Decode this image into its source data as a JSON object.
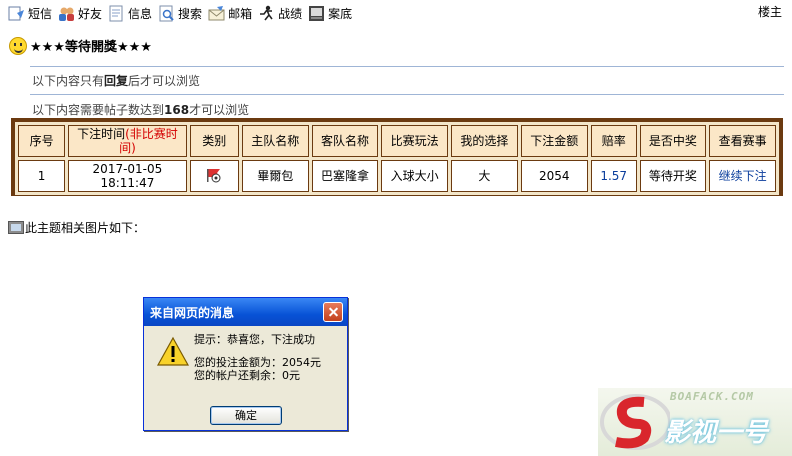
{
  "toolbar": {
    "items": [
      {
        "label": "短信",
        "icon": "message-icon"
      },
      {
        "label": "好友",
        "icon": "friends-icon"
      },
      {
        "label": "信息",
        "icon": "info-icon"
      },
      {
        "label": "搜索",
        "icon": "search-icon"
      },
      {
        "label": "邮箱",
        "icon": "mail-icon"
      },
      {
        "label": "战绩",
        "icon": "record-icon"
      },
      {
        "label": "案底",
        "icon": "file-icon"
      }
    ],
    "floor_label": "楼主"
  },
  "post": {
    "title": "★★★等待開獎★★★",
    "notice1_prefix": "以下内容只有",
    "notice1_bold": "回复",
    "notice1_suffix": "后才可以浏览",
    "notice2_prefix": "以下内容需要帖子数达到",
    "notice2_bold": "168",
    "notice2_suffix": "才可以浏览",
    "attach_text": "此主题相关图片如下："
  },
  "bet_table": {
    "headers": {
      "index": "序号",
      "time": "下注时间",
      "time_note": "(非比赛时间)",
      "type": "类别",
      "home": "主队名称",
      "away": "客队名称",
      "play": "比赛玩法",
      "choice": "我的选择",
      "amount": "下注金额",
      "odds": "赔率",
      "won": "是否中奖",
      "view": "查看赛事"
    },
    "row": {
      "index": "1",
      "time": "2017-01-05 18:11:47",
      "home": "畢爾包",
      "away": "巴塞隆拿",
      "play": "入球大小",
      "choice": "大",
      "amount": "2054",
      "odds": "1.57",
      "won": "等待开奖",
      "view": "继续下注"
    }
  },
  "dialog": {
    "title": "来自网页的消息",
    "line1": "提示：恭喜您，下注成功",
    "line2": "您的投注金额为：2054元",
    "line3": "您的帐户还剩余：0元",
    "ok_label": "确定"
  },
  "watermark": {
    "top": "BOAFACK.COM",
    "bottom": "影视一号"
  },
  "colors": {
    "table_border": "#6b3a10",
    "highlight_red": "#d40000",
    "link_blue": "#0a3d9c",
    "dialog_title": "#0752d6"
  }
}
